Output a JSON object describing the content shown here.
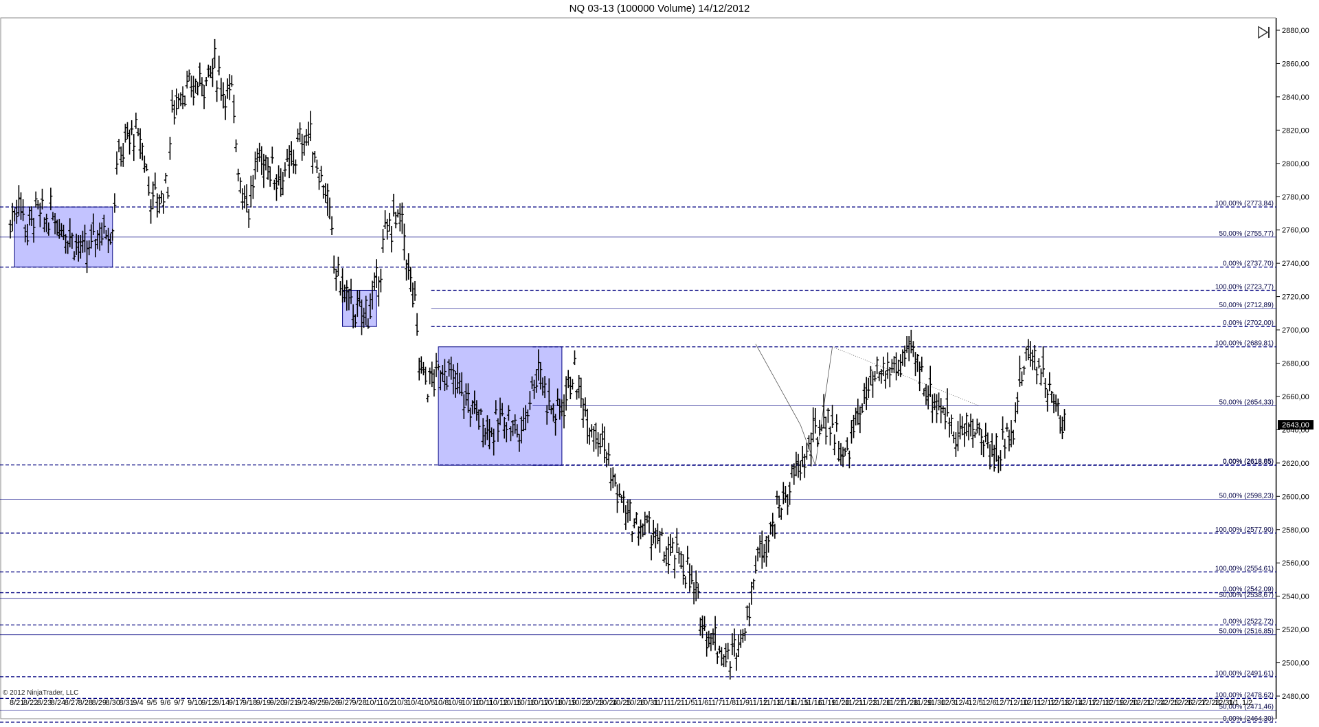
{
  "title": "NQ 03-13 (100000 Volume)  14/12/2012",
  "copyright": "© 2012 NinjaTrader, LLC",
  "current_price_label": "2643,00",
  "colors": {
    "price_bar": "#000000",
    "fib_line": "#000080",
    "box_fill": "#b8b8ff",
    "box_stroke": "#000080",
    "price_badge": "#000000"
  },
  "icons": {
    "nav": "skip-to-end-icon"
  },
  "chart_data": {
    "type": "bar",
    "subtype": "ohlc",
    "ylim": [
      2460,
      2890
    ],
    "grid": false,
    "y_ticks": [
      "2880,00",
      "2860,00",
      "2840,00",
      "2820,00",
      "2800,00",
      "2780,00",
      "2760,00",
      "2740,00",
      "2720,00",
      "2700,00",
      "2680,00",
      "2660,00",
      "2640,00",
      "2620,00",
      "2600,00",
      "2580,00",
      "2560,00",
      "2540,00",
      "2520,00",
      "2500,00",
      "2480,00"
    ],
    "x_ticks": [
      "8/21",
      "8/22",
      "8/23",
      "8/24",
      "8/27",
      "8/28",
      "8/29",
      "8/30",
      "8/31",
      "9/4",
      "9/5",
      "9/6",
      "9/7",
      "9/10",
      "9/12",
      "9/14",
      "9/17",
      "9/18",
      "9/19",
      "9/20",
      "9/21",
      "9/24",
      "9/25",
      "9/26",
      "9/27",
      "9/28",
      "10/1",
      "10/2",
      "10/3",
      "10/4",
      "10/5",
      "10/8",
      "10/9",
      "10/10",
      "10/11",
      "10/12",
      "10/15",
      "10/16",
      "10/17",
      "10/18",
      "10/19",
      "10/22",
      "10/23",
      "10/24",
      "10/25",
      "10/26",
      "10/31",
      "11/1",
      "11/2",
      "11/5",
      "11/6",
      "11/7",
      "11/8",
      "11/9",
      "11/12",
      "11/13",
      "11/14",
      "11/15",
      "11/16",
      "11/19",
      "11/20",
      "11/21",
      "11/23",
      "11/26",
      "11/27",
      "11/28",
      "11/29",
      "11/30",
      "12/3",
      "12/4",
      "12/5",
      "12/6",
      "12/7",
      "12/10",
      "12/11",
      "12/12",
      "12/13",
      "12/14",
      "12/17",
      "12/18",
      "12/19",
      "12/20",
      "12/21",
      "12/24",
      "12/25",
      "12/26",
      "12/27",
      "12/28",
      "12/31",
      "1/1",
      "1/2"
    ],
    "fib_levels": [
      {
        "label": "100,00% (2773,84)",
        "value": 2773.84,
        "style": "dashed",
        "x_start": 0,
        "x_end": 1
      },
      {
        "label": "50,00% (2755,77)",
        "value": 2755.77,
        "style": "solid",
        "x_start": 0,
        "x_end": 1
      },
      {
        "label": "0,00% (2737,70)",
        "value": 2737.7,
        "style": "dashed",
        "x_start": 0,
        "x_end": 1
      },
      {
        "label": "100,00% (2723,77)",
        "value": 2723.77,
        "style": "dashed",
        "x_start": 0.34,
        "x_end": 1
      },
      {
        "label": "50,00% (2712,89)",
        "value": 2712.89,
        "style": "solid",
        "x_start": 0.34,
        "x_end": 1
      },
      {
        "label": "0,00% (2702,00)",
        "value": 2702.0,
        "style": "dashed",
        "x_start": 0.34,
        "x_end": 1
      },
      {
        "label": "100,00% (2689,81)",
        "value": 2689.81,
        "style": "dashed",
        "x_start": 0.42,
        "x_end": 1
      },
      {
        "label": "50,00% (2654,33)",
        "value": 2654.33,
        "style": "solid",
        "x_start": 0.42,
        "x_end": 1
      },
      {
        "label": "0,00% (2618,85)",
        "value": 2618.85,
        "style": "dashed",
        "x_start": 0,
        "x_end": 1
      },
      {
        "label": "0,00% (2618,65)",
        "value": 2618.65,
        "style": "dashed",
        "x_start": 0.42,
        "x_end": 1
      },
      {
        "label": "50,00% (2598,23)",
        "value": 2598.23,
        "style": "solid",
        "x_start": 0,
        "x_end": 1
      },
      {
        "label": "100,00% (2577,90)",
        "value": 2577.9,
        "style": "dashed",
        "x_start": 0,
        "x_end": 1
      },
      {
        "label": "100,00% (2554,61)",
        "value": 2554.61,
        "style": "dashed",
        "x_start": 0,
        "x_end": 1
      },
      {
        "label": "0,00% (2542,09)",
        "value": 2542.09,
        "style": "dashed",
        "x_start": 0,
        "x_end": 1
      },
      {
        "label": "50,00% (2538,67)",
        "value": 2538.67,
        "style": "solid",
        "x_start": 0,
        "x_end": 1
      },
      {
        "label": "0,00% (2522,72)",
        "value": 2522.72,
        "style": "dashed",
        "x_start": 0,
        "x_end": 1
      },
      {
        "label": "50,00% (2516,85)",
        "value": 2516.85,
        "style": "solid",
        "x_start": 0,
        "x_end": 1
      },
      {
        "label": "100,00% (2491,61)",
        "value": 2491.61,
        "style": "dashed",
        "x_start": 0,
        "x_end": 1
      },
      {
        "label": "100,00% (2478,62)",
        "value": 2478.62,
        "style": "dashed",
        "x_start": 0,
        "x_end": 1
      },
      {
        "label": "50,00% (2471,46)",
        "value": 2471.46,
        "style": "solid",
        "x_start": 0,
        "x_end": 1
      },
      {
        "label": "0,00% (2464,30)",
        "value": 2464.3,
        "style": "dashed",
        "x_start": 0,
        "x_end": 1
      }
    ],
    "range_boxes": [
      {
        "bar_start": 2,
        "bar_end": 48,
        "high": 2773.84,
        "low": 2737.7
      },
      {
        "bar_start": 156,
        "bar_end": 172,
        "high": 2723.77,
        "low": 2702.0
      },
      {
        "bar_start": 201,
        "bar_end": 259,
        "high": 2689.81,
        "low": 2618.65
      }
    ],
    "trend_lines": [
      {
        "from": [
          386,
          2689.81
        ],
        "to": [
          455,
          2654.33
        ],
        "style": "dotted"
      },
      {
        "from": [
          350,
          2691.5
        ],
        "to": [
          371,
          2643.0
        ],
        "style": "solid"
      },
      {
        "from": [
          371,
          2643.0
        ],
        "to": [
          378,
          2618.65
        ],
        "style": "solid"
      },
      {
        "from": [
          378,
          2618.65
        ],
        "to": [
          386,
          2689.81
        ],
        "style": "solid"
      }
    ],
    "anchors": [
      [
        0,
        2763
      ],
      [
        4,
        2780
      ],
      [
        8,
        2760
      ],
      [
        12,
        2772
      ],
      [
        16,
        2765
      ],
      [
        20,
        2770
      ],
      [
        24,
        2762
      ],
      [
        28,
        2758
      ],
      [
        32,
        2750
      ],
      [
        36,
        2745
      ],
      [
        40,
        2758
      ],
      [
        44,
        2760
      ],
      [
        48,
        2762
      ],
      [
        50,
        2800
      ],
      [
        54,
        2812
      ],
      [
        58,
        2818
      ],
      [
        62,
        2810
      ],
      [
        66,
        2780
      ],
      [
        70,
        2778
      ],
      [
        74,
        2790
      ],
      [
        76,
        2830
      ],
      [
        80,
        2845
      ],
      [
        84,
        2842
      ],
      [
        88,
        2848
      ],
      [
        92,
        2852
      ],
      [
        96,
        2858
      ],
      [
        100,
        2845
      ],
      [
        104,
        2840
      ],
      [
        108,
        2790
      ],
      [
        112,
        2775
      ],
      [
        116,
        2800
      ],
      [
        120,
        2802
      ],
      [
        124,
        2795
      ],
      [
        128,
        2790
      ],
      [
        132,
        2800
      ],
      [
        136,
        2812
      ],
      [
        140,
        2818
      ],
      [
        144,
        2800
      ],
      [
        148,
        2785
      ],
      [
        150,
        2765
      ],
      [
        152,
        2740
      ],
      [
        156,
        2725
      ],
      [
        160,
        2715
      ],
      [
        164,
        2708
      ],
      [
        168,
        2712
      ],
      [
        172,
        2725
      ],
      [
        176,
        2755
      ],
      [
        180,
        2768
      ],
      [
        184,
        2762
      ],
      [
        186,
        2745
      ],
      [
        188,
        2725
      ],
      [
        190,
        2715
      ],
      [
        192,
        2680
      ],
      [
        196,
        2668
      ],
      [
        200,
        2672
      ],
      [
        204,
        2678
      ],
      [
        208,
        2668
      ],
      [
        212,
        2662
      ],
      [
        216,
        2655
      ],
      [
        220,
        2648
      ],
      [
        224,
        2642
      ],
      [
        228,
        2640
      ],
      [
        232,
        2650
      ],
      [
        236,
        2642
      ],
      [
        240,
        2638
      ],
      [
        244,
        2662
      ],
      [
        248,
        2678
      ],
      [
        252,
        2660
      ],
      [
        256,
        2648
      ],
      [
        260,
        2658
      ],
      [
        264,
        2675
      ],
      [
        268,
        2660
      ],
      [
        272,
        2645
      ],
      [
        276,
        2640
      ],
      [
        280,
        2628
      ],
      [
        282,
        2612
      ],
      [
        286,
        2600
      ],
      [
        290,
        2588
      ],
      [
        294,
        2580
      ],
      [
        298,
        2582
      ],
      [
        302,
        2578
      ],
      [
        306,
        2568
      ],
      [
        310,
        2562
      ],
      [
        314,
        2565
      ],
      [
        318,
        2555
      ],
      [
        322,
        2538
      ],
      [
        326,
        2522
      ],
      [
        330,
        2515
      ],
      [
        334,
        2508
      ],
      [
        338,
        2500
      ],
      [
        342,
        2515
      ],
      [
        346,
        2525
      ],
      [
        348,
        2548
      ],
      [
        352,
        2568
      ],
      [
        356,
        2578
      ],
      [
        360,
        2590
      ],
      [
        364,
        2600
      ],
      [
        368,
        2612
      ],
      [
        372,
        2620
      ],
      [
        376,
        2632
      ],
      [
        380,
        2642
      ],
      [
        384,
        2648
      ],
      [
        388,
        2635
      ],
      [
        392,
        2622
      ],
      [
        396,
        2640
      ],
      [
        400,
        2655
      ],
      [
        404,
        2665
      ],
      [
        408,
        2672
      ],
      [
        412,
        2675
      ],
      [
        416,
        2678
      ],
      [
        420,
        2682
      ],
      [
        424,
        2686
      ],
      [
        428,
        2672
      ],
      [
        432,
        2662
      ],
      [
        436,
        2655
      ],
      [
        440,
        2648
      ],
      [
        444,
        2640
      ],
      [
        448,
        2638
      ],
      [
        452,
        2642
      ],
      [
        456,
        2636
      ],
      [
        460,
        2628
      ],
      [
        464,
        2625
      ],
      [
        468,
        2638
      ],
      [
        472,
        2648
      ],
      [
        476,
        2682
      ],
      [
        480,
        2686
      ],
      [
        484,
        2678
      ],
      [
        488,
        2660
      ],
      [
        492,
        2650
      ],
      [
        495,
        2643
      ]
    ]
  }
}
